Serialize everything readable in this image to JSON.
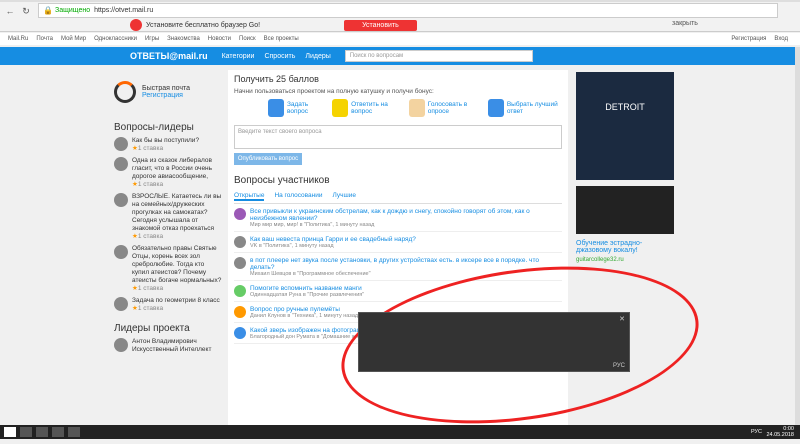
{
  "browser": {
    "secure_label": "Защищено",
    "url": "https://otvet.mail.ru"
  },
  "ad": {
    "text": "Установите бесплатно браузер Go!",
    "button": "Установить",
    "close": "закрыть"
  },
  "menubar": {
    "items": [
      "Mail.Ru",
      "Почта",
      "Мой Мир",
      "Одноклассники",
      "Игры",
      "Знакомства",
      "Новости",
      "Поиск",
      "Все проекты"
    ],
    "register": "Регистрация",
    "login": "Вход"
  },
  "header": {
    "logo": "ОТВЕТЫ@mail.ru",
    "categories": "Категории",
    "ask": "Спросить",
    "leaders": "Лидеры",
    "search_placeholder": "Поиск по вопросам"
  },
  "left": {
    "mail_title": "Быстрая почта",
    "mail_link": "Регистрация",
    "leaders_title": "Вопросы-лидеры",
    "leaders": [
      {
        "text": "Как бы вы поступили?",
        "stars": "1 ставка"
      },
      {
        "text": "Одна из сказок либералов гласит, что в России очень дорогое авиасообщение,",
        "stars": "1 ставка"
      },
      {
        "text": "ВЗРОСЛЫЕ. Катаетесь ли вы на семейных/дружеских прогулках на самокатах? Сегодня услышала от знакомой отказ проехаться",
        "stars": "1 ставка"
      },
      {
        "text": "Обязательно правы Святые Отцы, корень всех зол сребролюбие. Тогда кто купил атеистов? Почему атеисты богаче нормальных?",
        "stars": "1 ставка"
      },
      {
        "text": "Задача по геометрии 8 класс",
        "stars": "1 ставка"
      }
    ],
    "project_leaders_title": "Лидеры проекта",
    "project_leader": "Антон Владимирович",
    "project_leader_role": "Искусственный Интеллект"
  },
  "promo": {
    "title": "Получить 25 баллов",
    "subtitle": "Начни пользоваться проектом на полную катушку и получи бонус:",
    "steps": [
      "Задать вопрос",
      "Ответить на вопрос",
      "Голосовать в опросе",
      "Выбрать лучший ответ"
    ]
  },
  "askbox": {
    "placeholder": "Введите текст своего вопроса",
    "button": "Опубликовать вопрос"
  },
  "questions": {
    "title": "Вопросы участников",
    "tabs": [
      "Открытые",
      "На голосовании",
      "Лучшие"
    ],
    "items": [
      {
        "text": "Все привыкли к украинским обстрелам, как к дождю и снегу, спокойно говорят об этом, как о неизбежном явлении?",
        "meta": "Мир мир мир, мир! в \"Политика\", 1 минуту назад"
      },
      {
        "text": "Как ваш невеста принца Гарри и ее свадебный наряд?",
        "meta": "VK в \"Политика\", 1 минуту назад"
      },
      {
        "text": "в пот плеере нет звука после установки, в других устройствах есть. в иксере все в порядке. что делать?",
        "meta": "Михаил Шевцов в \"Программное обеспечение\""
      },
      {
        "text": "Помогите вспомнить название манги",
        "meta": "Одиннадцатая Руна в \"Прочие развлечения\""
      },
      {
        "text": "Вопрос про ручные пулемёты",
        "meta": "Данил Клунов в \"Техника\", 1 минуту назад"
      },
      {
        "text": "Какой зверь изображен на фотографии?",
        "meta": "Благородный дон Румата в \"Домашние животные\", 1 минуту назад"
      }
    ]
  },
  "right": {
    "banner": "DETROIT",
    "ad_text": "Обучение эстрадно-джазовому вокалу!",
    "ad_link": "guitarcollege32.ru"
  },
  "overlay": {
    "lang": "РУС"
  },
  "taskbar": {
    "time": "0:00",
    "date": "24.05.2018",
    "lang": "РУС"
  }
}
